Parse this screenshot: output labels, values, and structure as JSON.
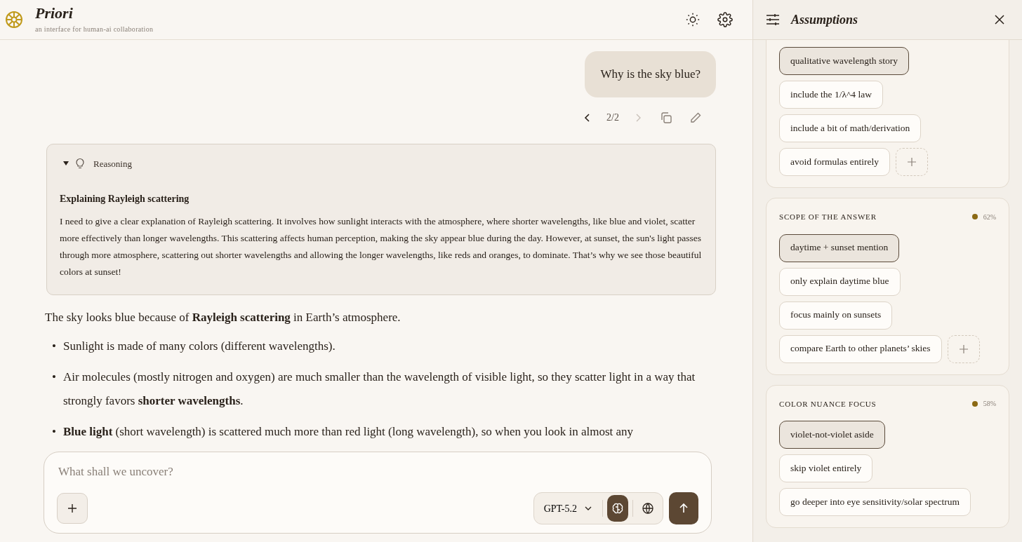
{
  "app": {
    "name": "Priori",
    "tagline": "an interface for human-ai collaboration"
  },
  "conversation": {
    "user_message": "Why is the sky blue?",
    "version": "2/2",
    "reasoning": {
      "label": "Reasoning",
      "expanded": true,
      "title": "Explaining Rayleigh scattering",
      "text": "I need to give a clear explanation of Rayleigh scattering. It involves how sunlight interacts with the atmosphere, where shorter wavelengths, like blue and violet, scatter more effectively than longer wavelengths. This scattering affects human perception, making the sky appear blue during the day. However, at sunset, the sun's light passes through more atmosphere, scattering out shorter wavelengths and allowing the longer wavelengths, like reds and oranges, to dominate. That’s why we see those beautiful colors at sunset!"
    },
    "answer_intro": "The sky looks blue because of **Rayleigh scattering** in Earth’s atmosphere.",
    "bullets": [
      {
        "marker": "•",
        "text": "Sunlight is made of many colors (different wavelengths)."
      },
      {
        "marker": "•",
        "text": "Air molecules (mostly nitrogen and oxygen) are much smaller than the wavelength of visible light, so they scatter light in a way that strongly favors **shorter wavelengths**."
      },
      {
        "marker": "•",
        "text": "**Blue light** (short wavelength) is scattered much more than red light (long wavelength), so when you look in almost any"
      }
    ]
  },
  "composer": {
    "placeholder": "What shall we uncover?",
    "model": "GPT-5.2",
    "reasoning_on": true,
    "web_on": false
  },
  "assumptions": {
    "title": "Assumptions",
    "sections": [
      {
        "options": [
          {
            "label": "qualitative wavelength story",
            "selected": true
          },
          {
            "label": "include the 1/λ^4 law",
            "selected": false
          },
          {
            "label": "include a bit of math/derivation",
            "selected": false
          },
          {
            "label": "avoid formulas entirely",
            "selected": false
          }
        ]
      },
      {
        "title": "SCOPE OF THE ANSWER",
        "color": "#8b6914",
        "confidence": "62%",
        "options": [
          {
            "label": "daytime + sunset mention",
            "selected": true
          },
          {
            "label": "only explain daytime blue",
            "selected": false
          },
          {
            "label": "focus mainly on sunsets",
            "selected": false
          },
          {
            "label": "compare Earth to other planets’ skies",
            "selected": false
          }
        ]
      },
      {
        "title": "COLOR NUANCE FOCUS",
        "color": "#8b6914",
        "confidence": "58%",
        "options": [
          {
            "label": "violet-not-violet aside",
            "selected": true
          },
          {
            "label": "skip violet entirely",
            "selected": false
          },
          {
            "label": "go deeper into eye sensitivity/solar spectrum",
            "selected": false
          }
        ]
      }
    ]
  }
}
